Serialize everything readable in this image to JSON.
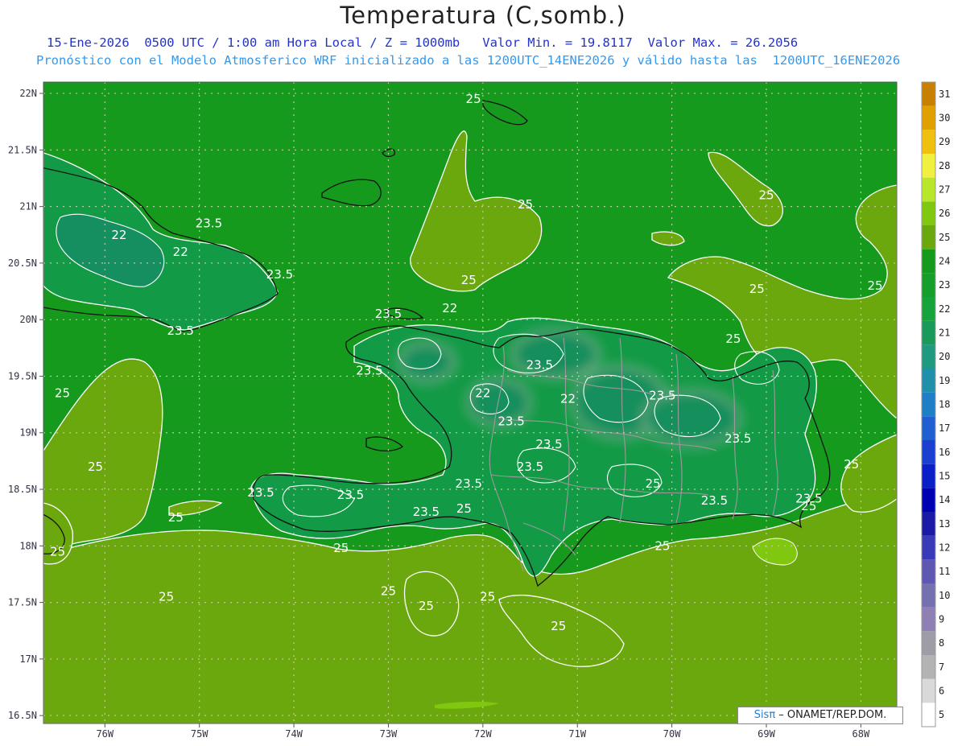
{
  "header": {
    "title": "Temperatura (C,somb.)",
    "line1": "15-Ene-2026  0500 UTC / 1:00 am Hora Local / Z = 1000mb   Valor Min. = 19.8117  Valor Max. = 26.2056",
    "line2": "Pronóstico con el Modelo Atmosferico WRF inicializado a las 1200UTC_14ENE2026 y válido hasta las  1200UTC_16ENE2026"
  },
  "axes": {
    "lat_labels": [
      "22N",
      "21.5N",
      "21N",
      "20.5N",
      "20N",
      "19.5N",
      "19N",
      "18.5N",
      "18N",
      "17.5N",
      "17N",
      "16.5N"
    ],
    "lat_values": [
      22,
      21.5,
      21,
      20.5,
      20,
      19.5,
      19,
      18.5,
      18,
      17.5,
      17,
      16.5
    ],
    "lon_labels": [
      "76W",
      "75W",
      "74W",
      "73W",
      "72W",
      "71W",
      "70W",
      "69W",
      "68W"
    ],
    "lon_values": [
      -76,
      -75,
      -74,
      -73,
      -72,
      -71,
      -70,
      -69,
      -68
    ],
    "lat_range": [
      16.43,
      22.1
    ],
    "lon_range": [
      -76.65,
      -67.62
    ]
  },
  "colorbar": {
    "levels": [
      "5",
      "6",
      "7",
      "8",
      "9",
      "10",
      "11",
      "12",
      "13",
      "14",
      "15",
      "16",
      "17",
      "18",
      "19",
      "20",
      "21",
      "22",
      "23",
      "24",
      "25",
      "26",
      "27",
      "28",
      "29",
      "30",
      "31"
    ],
    "colors": [
      "#ffffff",
      "#d9d9d9",
      "#b3b3b3",
      "#9d9da8",
      "#8e7fb4",
      "#7570b0",
      "#5e58b3",
      "#3a3ab8",
      "#1a1aa6",
      "#0000b3",
      "#0a1fc7",
      "#1a3fd1",
      "#1f5fd1",
      "#1f7fc6",
      "#1f8faa",
      "#1f9980",
      "#1a9a5a",
      "#17a33c",
      "#159f2a",
      "#169a1e",
      "#6aa80e",
      "#80c80f",
      "#b8e62a",
      "#f0f040",
      "#f0c00e",
      "#e0a000",
      "#c88000"
    ]
  },
  "contours": {
    "labels": [
      "22",
      "22",
      "22",
      "22",
      "22",
      "23.5",
      "23.5",
      "23.5",
      "23.5",
      "23.5",
      "23.5",
      "23.5",
      "23.5",
      "23.5",
      "23.5",
      "23.5",
      "23.5",
      "23.5",
      "23.5",
      "23.5",
      "23.5",
      "23.5",
      "25",
      "25",
      "25",
      "25",
      "25",
      "25",
      "25",
      "25",
      "25",
      "25",
      "25",
      "25",
      "25",
      "25",
      "25",
      "25",
      "25",
      "25",
      "25",
      "25",
      "25",
      "25"
    ],
    "label_positions": [
      [
        -75.85,
        20.75
      ],
      [
        -75.2,
        20.6
      ],
      [
        -72.35,
        20.1
      ],
      [
        -72.0,
        19.35
      ],
      [
        -71.1,
        19.3
      ],
      [
        -74.9,
        20.85
      ],
      [
        -74.15,
        20.4
      ],
      [
        -75.2,
        19.9
      ],
      [
        -73.0,
        20.05
      ],
      [
        -73.2,
        19.55
      ],
      [
        -72.6,
        18.3
      ],
      [
        -71.7,
        19.1
      ],
      [
        -71.3,
        18.9
      ],
      [
        -71.4,
        19.6
      ],
      [
        -70.1,
        19.33
      ],
      [
        -69.55,
        18.4
      ],
      [
        -69.3,
        18.95
      ],
      [
        -68.55,
        18.42
      ],
      [
        -74.35,
        18.47
      ],
      [
        -73.4,
        18.45
      ],
      [
        -72.15,
        18.55
      ],
      [
        -71.5,
        18.7
      ],
      [
        -70.2,
        18.55
      ],
      [
        -72.1,
        21.95
      ],
      [
        -71.55,
        21.02
      ],
      [
        -72.15,
        20.35
      ],
      [
        -69.0,
        21.1
      ],
      [
        -69.1,
        20.27
      ],
      [
        -67.85,
        20.3
      ],
      [
        -69.35,
        19.83
      ],
      [
        -76.45,
        19.35
      ],
      [
        -76.1,
        18.7
      ],
      [
        -75.25,
        18.25
      ],
      [
        -76.5,
        17.95
      ],
      [
        -73.5,
        17.98
      ],
      [
        -72.2,
        18.33
      ],
      [
        -73.0,
        17.6
      ],
      [
        -72.6,
        17.47
      ],
      [
        -71.95,
        17.55
      ],
      [
        -71.2,
        17.29
      ],
      [
        -75.35,
        17.55
      ],
      [
        -70.1,
        18.0
      ],
      [
        -68.55,
        18.35
      ],
      [
        -68.1,
        18.72
      ]
    ]
  },
  "legend_credit": {
    "sis": "Sisπ",
    "rest": " – ONAMET/REP.DOM."
  }
}
